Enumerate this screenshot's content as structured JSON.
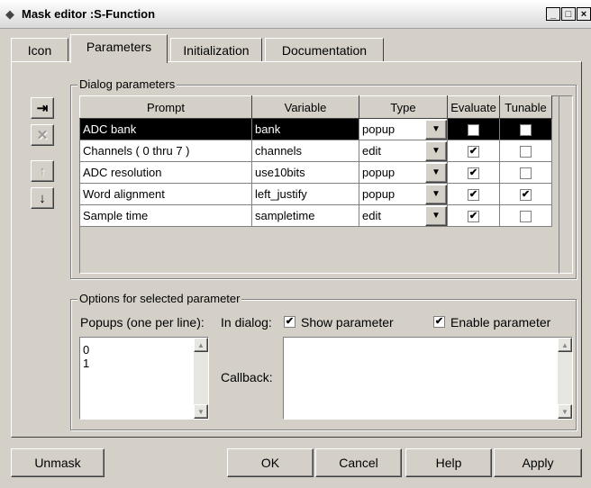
{
  "window": {
    "title": "Mask editor :S-Function",
    "icon": "matlab-icon",
    "controls": [
      "_",
      "□",
      "×"
    ]
  },
  "tabs": [
    {
      "label": "Icon",
      "active": false
    },
    {
      "label": "Parameters",
      "active": true
    },
    {
      "label": "Initialization",
      "active": false
    },
    {
      "label": "Documentation",
      "active": false
    }
  ],
  "dialog_params": {
    "group_label": "Dialog parameters",
    "side_buttons": [
      {
        "name": "add-param-button",
        "icon": "add-icon",
        "glyph": "⇥",
        "enabled": true
      },
      {
        "name": "delete-param-button",
        "icon": "delete-icon",
        "glyph": "✕",
        "enabled": false
      },
      {
        "name": "move-up-button",
        "icon": "move-up-icon",
        "glyph": "↑",
        "enabled": false
      },
      {
        "name": "move-down-button",
        "icon": "move-down-icon",
        "glyph": "↓",
        "enabled": true
      }
    ],
    "columns": [
      "Prompt",
      "Variable",
      "Type",
      "Evaluate",
      "Tunable"
    ],
    "rows": [
      {
        "prompt": "ADC bank",
        "variable": "bank",
        "type": "popup",
        "evaluate": true,
        "tunable": false,
        "selected": true
      },
      {
        "prompt": "Channels ( 0 thru 7 )",
        "variable": "channels",
        "type": "edit",
        "evaluate": true,
        "tunable": false,
        "selected": false
      },
      {
        "prompt": "ADC resolution",
        "variable": "use10bits",
        "type": "popup",
        "evaluate": true,
        "tunable": false,
        "selected": false
      },
      {
        "prompt": "Word alignment",
        "variable": "left_justify",
        "type": "popup",
        "evaluate": true,
        "tunable": true,
        "selected": false
      },
      {
        "prompt": "Sample time",
        "variable": "sampletime",
        "type": "edit",
        "evaluate": true,
        "tunable": false,
        "selected": false
      }
    ]
  },
  "options": {
    "group_label": "Options for selected parameter",
    "popups_label": "Popups (one per line):",
    "popups_text": "0\n1",
    "in_dialog_label": "In dialog:",
    "show_param_label": "Show parameter",
    "show_param_checked": true,
    "enable_param_label": "Enable parameter",
    "enable_param_checked": true,
    "callback_label": "Callback:",
    "callback_text": ""
  },
  "buttons": {
    "unmask": "Unmask",
    "ok": "OK",
    "cancel": "Cancel",
    "help": "Help",
    "apply": "Apply"
  }
}
